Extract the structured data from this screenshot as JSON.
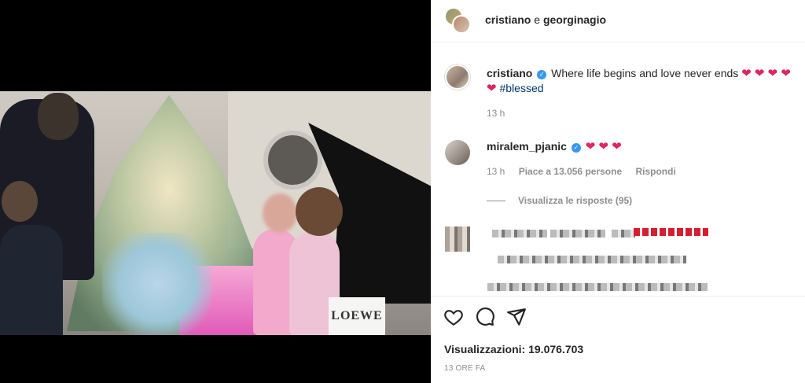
{
  "header": {
    "owner1": "cristiano",
    "conjunction": "e",
    "owner2": "georginagio"
  },
  "caption": {
    "username": "cristiano",
    "text": "Where life begins and love never ends",
    "hearts_line1": "❤ ❤ ❤ ❤",
    "heart_line2": "❤",
    "hashtag": "#blessed",
    "time": "13 h"
  },
  "comment": {
    "username": "miralem_pjanic",
    "text": "❤ ❤ ❤",
    "time": "13 h",
    "likes": "Piace a 13.056 persone",
    "reply": "Rispondi",
    "view_replies": "Visualizza le risposte (95)"
  },
  "video": {
    "bag_text": "LOEWE"
  },
  "footer": {
    "views_label": "Visualizzazioni:",
    "views_count": "19.076.703",
    "ago": "13 ORE FA"
  },
  "icons": [
    "heart-icon",
    "comment-icon",
    "share-icon",
    "verified-icon"
  ]
}
